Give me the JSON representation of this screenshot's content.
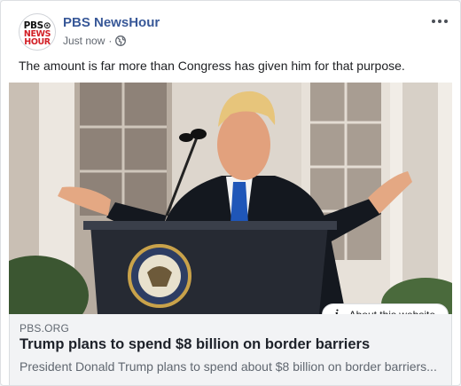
{
  "post": {
    "page_name": "PBS NewsHour",
    "timestamp": "Just now",
    "separator": "·",
    "privacy_icon": "globe-icon",
    "more_icon": "more-options-icon",
    "message": "The amount is far more than Congress has given him for that purpose.",
    "avatar": {
      "line1": "PBS⊙",
      "line2": "NEWS",
      "line3": "HOUR"
    }
  },
  "photo": {
    "about_label": "About this website",
    "about_icon": "info-icon"
  },
  "link_preview": {
    "domain": "PBS.ORG",
    "headline": "Trump plans to spend $8 billion on border barriers",
    "description": "President Donald Trump plans to spend about $8 billion on border barriers..."
  },
  "colors": {
    "page_name": "#385898",
    "link_box_bg": "#f2f3f5",
    "pbs_red": "#d21f26"
  }
}
